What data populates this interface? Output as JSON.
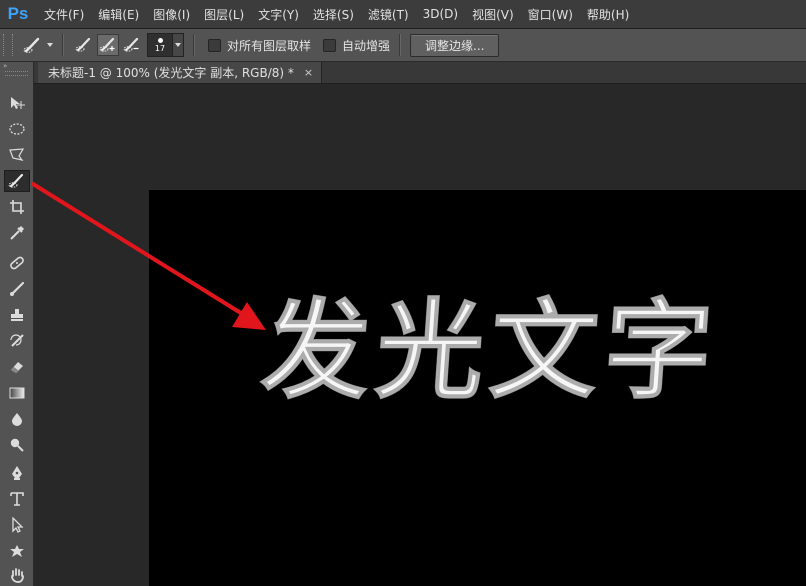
{
  "app": {
    "logo": "Ps",
    "menu": [
      "文件(F)",
      "编辑(E)",
      "图像(I)",
      "图层(L)",
      "文字(Y)",
      "选择(S)",
      "滤镜(T)",
      "3D(D)",
      "视图(V)",
      "窗口(W)",
      "帮助(H)"
    ]
  },
  "options": {
    "brush_size": "17",
    "sample_all_layers": "对所有图层取样",
    "auto_enhance": "自动增强",
    "refine_edge": "调整边缘..."
  },
  "document": {
    "tab_title": "未标题-1 @ 100% (发光文字 副本, RGB/8) *",
    "close_glyph": "×",
    "canvas_text": "发光文字"
  },
  "toolbox": {
    "header_glyph": "»",
    "active_tool": "quick-selection-tool"
  },
  "colors": {
    "accent_logo": "#3da3ff",
    "annotation_arrow": "#e0161c",
    "canvas_bg": "#000000",
    "text_fill": "#f6f6f6"
  }
}
